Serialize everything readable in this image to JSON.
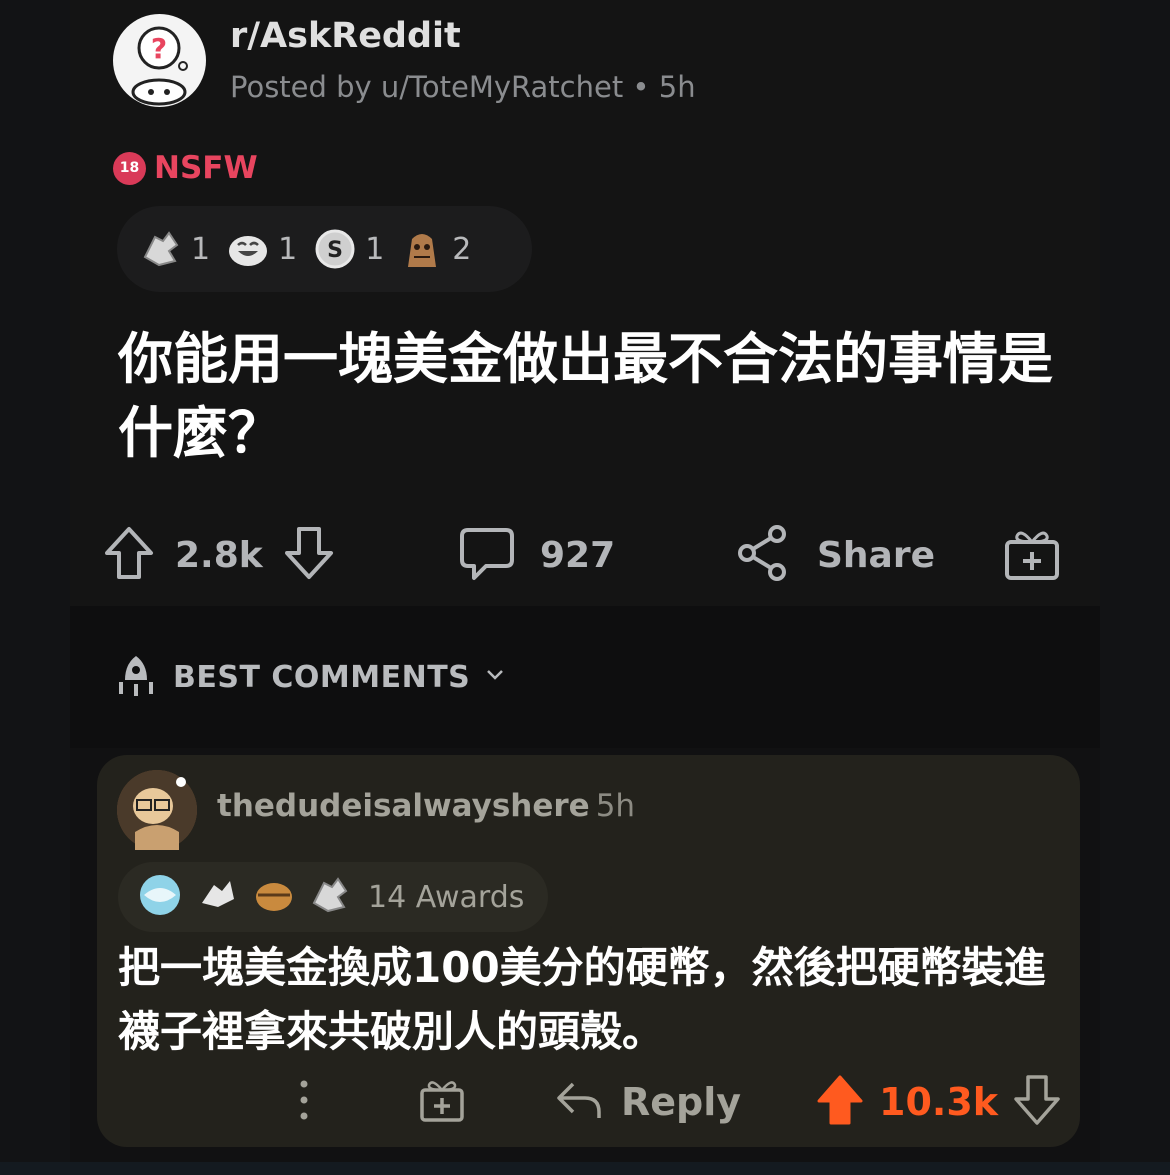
{
  "post": {
    "subreddit": "r/AskReddit",
    "posted_by": "Posted by u/ToteMyRatchet • 5h",
    "nsfw_badge": "18",
    "nsfw_label": "NSFW",
    "awards": [
      {
        "icon": "hands-award-icon",
        "count": "1"
      },
      {
        "icon": "laughing-face-award-icon",
        "count": "1"
      },
      {
        "icon": "silver-coin-award-icon",
        "count": "1"
      },
      {
        "icon": "sloth-award-icon",
        "count": "2"
      }
    ],
    "title": "你能用一塊美金做出最不合法的事情是什麼？",
    "upvotes": "2.8k",
    "comments_count": "927",
    "share_label": "Share"
  },
  "sort": {
    "label": "BEST COMMENTS"
  },
  "comment": {
    "username": "thedudeisalwayshere",
    "time": "5h",
    "awards_label": "14 Awards",
    "body": "把一塊美金換成100美分的硬幣，然後把硬幣裝進襪子裡拿來共破別人的頭殼。",
    "reply_label": "Reply",
    "upvotes": "10.3k"
  },
  "colors": {
    "upvote_active": "#ff5a1f",
    "nsfw": "#e8455f",
    "card_bg": "#23221c"
  }
}
